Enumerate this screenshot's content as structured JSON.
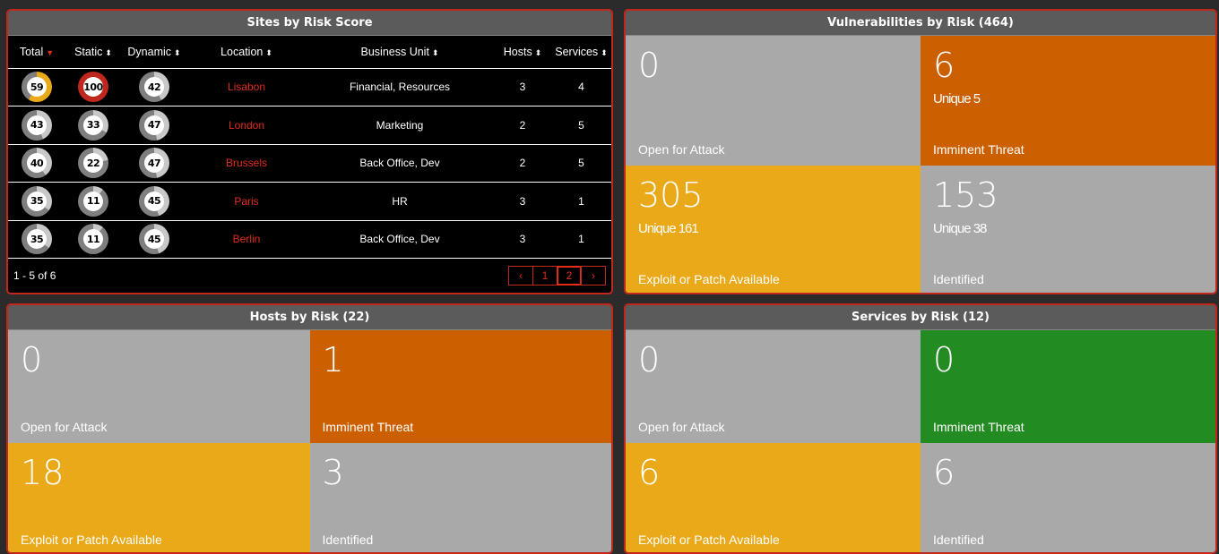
{
  "colors": {
    "accent": "#c0281e",
    "grey": "#a9a9a9",
    "orange": "#cc5f00",
    "yellow": "#e9a919",
    "green": "#228b22",
    "ring_grey": "#7f7f7f",
    "ring_light": "#c8c8c8",
    "ring_red": "#c0281e",
    "ring_yellow": "#e9a919"
  },
  "sites": {
    "title": "Sites by Risk Score",
    "columns": [
      "Total",
      "Static",
      "Dynamic",
      "Location",
      "Business Unit",
      "Hosts",
      "Services"
    ],
    "sort_icon_active": "caret-down-icon",
    "sort_icon": "sort-icon",
    "rows": [
      {
        "total": "59",
        "static": "100",
        "dynamic": "42",
        "location": "Lisabon",
        "business_unit": "Financial, Resources",
        "hosts": "3",
        "services": "4"
      },
      {
        "total": "43",
        "static": "33",
        "dynamic": "47",
        "location": "London",
        "business_unit": "Marketing",
        "hosts": "2",
        "services": "5"
      },
      {
        "total": "40",
        "static": "22",
        "dynamic": "47",
        "location": "Brussels",
        "business_unit": "Back Office, Dev",
        "hosts": "2",
        "services": "5"
      },
      {
        "total": "35",
        "static": "11",
        "dynamic": "45",
        "location": "Paris",
        "business_unit": "HR",
        "hosts": "3",
        "services": "1"
      },
      {
        "total": "35",
        "static": "11",
        "dynamic": "45",
        "location": "Berlin",
        "business_unit": "Back Office, Dev",
        "hosts": "3",
        "services": "1"
      }
    ],
    "range_text": "1 - 5 of 6",
    "pager": {
      "prev": "‹",
      "page1": "1",
      "page2": "2",
      "next": "›"
    }
  },
  "vulns": {
    "title": "Vulnerabilities by Risk (464)",
    "tiles": [
      {
        "number": "0",
        "unique": "",
        "label": "Open for Attack"
      },
      {
        "number": "6",
        "unique": "Unique 5",
        "label": "Imminent Threat"
      },
      {
        "number": "305",
        "unique": "Unique 161",
        "label": "Exploit or Patch Available"
      },
      {
        "number": "153",
        "unique": "Unique 38",
        "label": "Identified"
      }
    ]
  },
  "hosts": {
    "title": "Hosts by Risk (22)",
    "tiles": [
      {
        "number": "0",
        "label": "Open for Attack"
      },
      {
        "number": "1",
        "label": "Imminent Threat"
      },
      {
        "number": "18",
        "label": "Exploit or Patch Available"
      },
      {
        "number": "3",
        "label": "Identified"
      }
    ]
  },
  "services": {
    "title": "Services by Risk (12)",
    "tiles": [
      {
        "number": "0",
        "label": "Open for Attack"
      },
      {
        "number": "0",
        "label": "Imminent Threat"
      },
      {
        "number": "6",
        "label": "Exploit or Patch Available"
      },
      {
        "number": "6",
        "label": "Identified"
      }
    ]
  }
}
